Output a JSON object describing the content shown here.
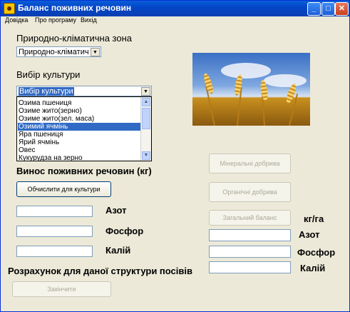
{
  "window": {
    "title": "Баланс поживних речовин",
    "controls": [
      "_",
      "□",
      "✕"
    ]
  },
  "menu": [
    "Довідка",
    "Про програму",
    "Вихід"
  ],
  "zone": {
    "label": "Природно-кліматична зона",
    "value": "Природно-кліматич"
  },
  "culture": {
    "label": "Вибір культури",
    "value": "Вибір культури",
    "options": [
      "Озима пшениця",
      "Озиме жито(зерно)",
      "Озиме жито(зел. маса)",
      "Озимий ячмінь",
      "Яра пшениця",
      "Ярий ячмінь",
      "Овес",
      "Кукурудза на зерно"
    ],
    "highlighted_option": "Озимий ячмінь"
  },
  "removal": {
    "label": "Винос поживних речовин (кг)",
    "button": "Обчислити для культури",
    "nitrogen": "Азот",
    "phosphorus": "Фосфор",
    "potassium": "Калій"
  },
  "right_panel": {
    "mineral_button": "Мінеральні добрива",
    "organic_button": "Органічні добрива",
    "balance_button": "Загальний баланс",
    "unit": "кг/га",
    "nitrogen": "Азот",
    "phosphorus": "Фосфор",
    "potassium": "Калій"
  },
  "structure_label": "Розрахунок для даної структури посівів",
  "finish_button": "Закінчити",
  "colors": {
    "titlebar": "#0346c8",
    "selection": "#316ac5",
    "window_bg": "#ece9d8"
  },
  "icons": {
    "photo": "wheat-field-photo",
    "app": "app-icon"
  }
}
